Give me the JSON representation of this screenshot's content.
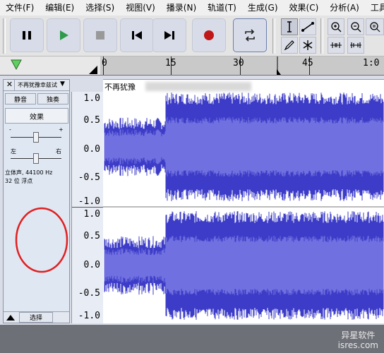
{
  "menubar": {
    "items": [
      "文件(F)",
      "编辑(E)",
      "选择(S)",
      "视图(V)",
      "播录(N)",
      "轨道(T)",
      "生成(G)",
      "效果(C)",
      "分析(A)",
      "工具(O)"
    ]
  },
  "toolbar": {
    "buttons": [
      "pause",
      "play",
      "stop",
      "skip-start",
      "skip-end",
      "record",
      "loop"
    ],
    "colors": {
      "play": "#2f9a4a",
      "record": "#c01818"
    }
  },
  "ruler": {
    "labels": [
      "0",
      "15",
      "30",
      "45"
    ],
    "overflow_label": "1:0"
  },
  "track": {
    "name": "不再犹豫幸兹试",
    "mute_label": "静音",
    "solo_label": "独奏",
    "effects_label": "效果",
    "gain_minus": "-",
    "gain_plus": "+",
    "pan_left": "左",
    "pan_right": "右",
    "format_line1": "立体声, 44100 Hz",
    "format_line2": "32 位 浮点",
    "select_label": "选择",
    "title_in_wave": "不再犹豫",
    "wave_color": "#3c3cc8",
    "wave_light_color": "#7070e0"
  },
  "vruler": {
    "channel1": [
      "1.0",
      "0.5",
      "0.0",
      "-0.5",
      "-1.0"
    ],
    "channel2": [
      "1.0",
      "0.5",
      "0.0",
      "-0.5",
      "-1.0"
    ]
  },
  "annotation": {
    "color": "#e02020"
  },
  "watermark": {
    "line1": "异星软件",
    "line2": "isres.com"
  }
}
